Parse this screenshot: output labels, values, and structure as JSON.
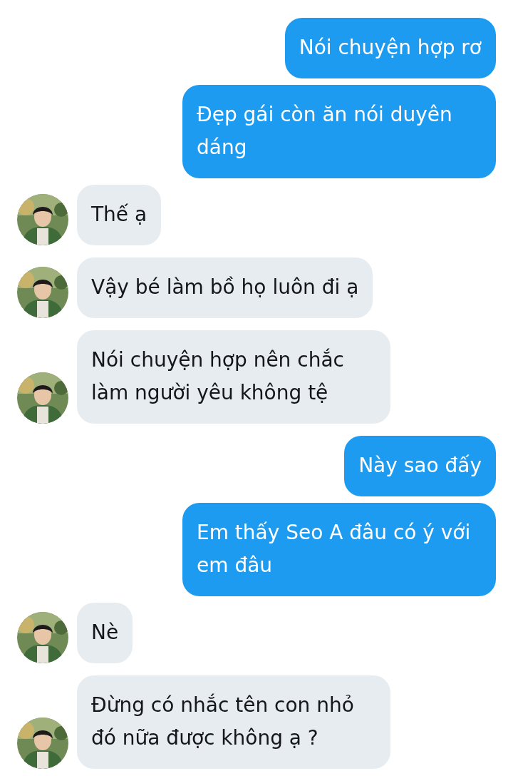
{
  "messages": [
    {
      "kind": "outgoing",
      "text": "Nói chuyện hợp rơ"
    },
    {
      "kind": "outgoing",
      "text": "Đẹp gái còn ăn nói duyên dáng"
    },
    {
      "kind": "incoming",
      "text": "Thế ạ"
    },
    {
      "kind": "incoming",
      "text": "Vậy bé làm bồ họ luôn đi ạ"
    },
    {
      "kind": "incoming",
      "text": "Nói chuyện hợp nên chắc làm người yêu không tệ"
    },
    {
      "kind": "outgoing",
      "text": "Này sao đấy"
    },
    {
      "kind": "outgoing",
      "text": "Em thấy Seo A đâu có ý với em đâu"
    },
    {
      "kind": "incoming",
      "text": "Nè"
    },
    {
      "kind": "incoming",
      "text": "Đừng có nhắc tên con nhỏ đó nữa được không ạ ?"
    }
  ]
}
